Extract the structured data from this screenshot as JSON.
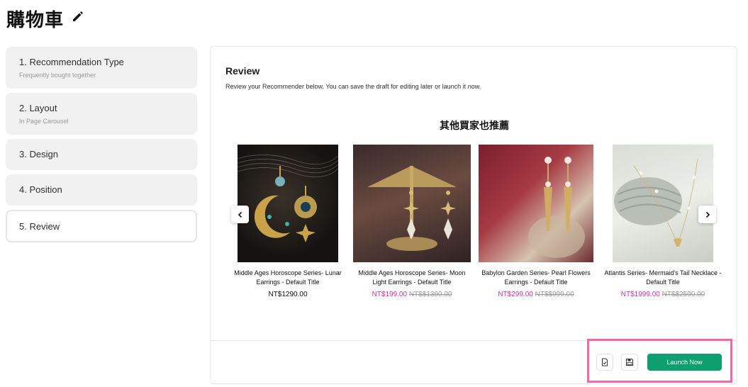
{
  "header": {
    "title": "購物車"
  },
  "steps": [
    {
      "title": "1. Recommendation Type",
      "subtitle": "Frequently bought together"
    },
    {
      "title": "2. Layout",
      "subtitle": "In Page Carousel"
    },
    {
      "title": "3. Design"
    },
    {
      "title": "4. Position"
    },
    {
      "title": "5. Review"
    }
  ],
  "review": {
    "title": "Review",
    "description": "Review your Recommender below. You can save the draft for editing later or launch it now.",
    "heading": "其他買家也推薦",
    "products": [
      {
        "name": "Middle Ages Horoscope Series- Lunar Earrings - Default Title",
        "price": "NT$1290.00"
      },
      {
        "name": "Middle Ages Horoscope Series- Moon Light Earrings - Default Title",
        "sale_price": "NT$199.00",
        "original_price": "NT$$1390.00"
      },
      {
        "name": "Babylon Garden Series- Pearl Flowers Earrings - Default Title",
        "sale_price": "NT$299.00",
        "original_price": "NT$$999.00"
      },
      {
        "name": "Atlantis Series- Mermaid's Tail Necklace - Default Title",
        "sale_price": "NT$1999.00",
        "original_price": "NT$$2590.00"
      }
    ]
  },
  "footer": {
    "launch_label": "Launch Now"
  },
  "colors": {
    "accent": "#0e9f6e",
    "sale": "#d6339e",
    "highlight": "#f06aa9"
  },
  "icons": [
    "pencil-icon",
    "chevron-left-icon",
    "chevron-right-icon",
    "document-check-icon",
    "save-disk-icon"
  ]
}
